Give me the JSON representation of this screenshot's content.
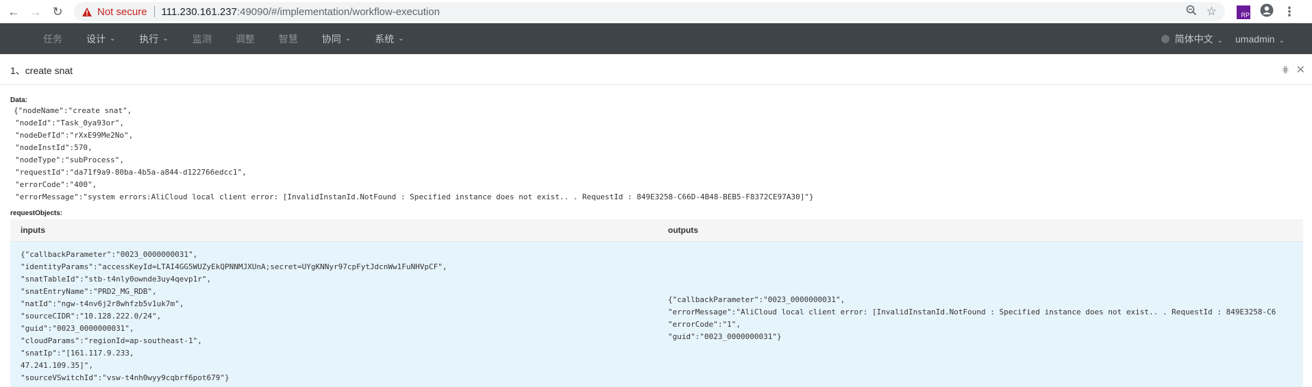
{
  "browser": {
    "security_label": "Not secure",
    "url_host": "111.230.161.237",
    "url_rest": ":49090/#/implementation/workflow-execution"
  },
  "nav": {
    "items": [
      {
        "label": "任务",
        "dropdown": false
      },
      {
        "label": "设计",
        "dropdown": true
      },
      {
        "label": "执行",
        "dropdown": true
      },
      {
        "label": "监测",
        "dropdown": false
      },
      {
        "label": "调整",
        "dropdown": false
      },
      {
        "label": "智慧",
        "dropdown": false
      },
      {
        "label": "协同",
        "dropdown": true
      },
      {
        "label": "系统",
        "dropdown": true
      }
    ],
    "language": "简体中文",
    "user": "umadmin"
  },
  "panel": {
    "title": "1、create snat"
  },
  "data_label": "Data:",
  "data_lines": [
    "{\"nodeName\":\"create snat\",",
    "\"nodeId\":\"Task_0ya93or\",",
    "\"nodeDefId\":\"rXxE99Me2No\",",
    "\"nodeInstId\":570,",
    "\"nodeType\":\"subProcess\",",
    "\"requestId\":\"da71f9a9-80ba-4b5a-a844-d122766edcc1\",",
    "\"errorCode\":\"400\",",
    "\"errorMessage\":\"system errors:AliCloud local client error: [InvalidInstanId.NotFound : Specified instance does not exist.. . RequestId : 849E3258-C66D-4B48-BEB5-F8372CE97A30]\"}"
  ],
  "request_label": "requestObjects:",
  "table": {
    "headers": {
      "inputs": "inputs",
      "outputs": "outputs"
    },
    "inputs_text": "{\"callbackParameter\":\"0023_0000000031\",\n\"identityParams\":\"accessKeyId=LTAI4GG5WUZyEkQPNNMJXUnA;secret=UYgKNNyr97cpFytJdcnWw1FuNHVpCF\",\n\"snatTableId\":\"stb-t4nly0ownde3uy4qevp1r\",\n\"snatEntryName\":\"PRD2_MG_RDB\",\n\"natId\":\"ngw-t4nv6j2r8whfzb5v1uk7m\",\n\"sourceCIDR\":\"10.128.222.0/24\",\n\"guid\":\"0023_0000000031\",\n\"cloudParams\":\"regionId=ap-southeast-1\",\n\"snatIp\":\"[161.117.9.233,\n47.241.109.35]\",\n\"sourceVSwitchId\":\"vsw-t4nh0wyy9cqbrf6pot679\"}",
    "outputs_text": "{\"callbackParameter\":\"0023_0000000031\",\n\"errorMessage\":\"AliCloud local client error: [InvalidInstanId.NotFound : Specified instance does not exist.. . RequestId : 849E3258-C6\n\"errorCode\":\"1\",\n\"guid\":\"0023_0000000031\"}"
  }
}
